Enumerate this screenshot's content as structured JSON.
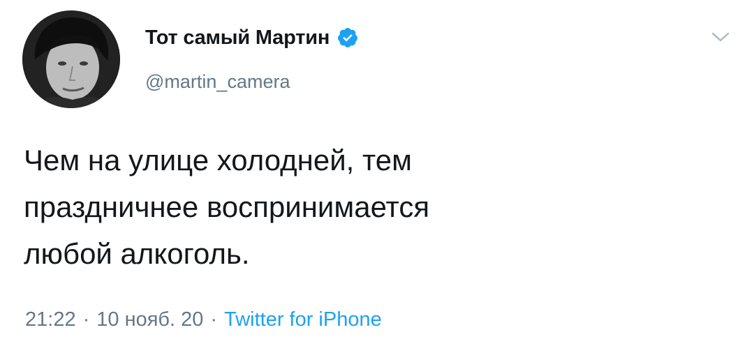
{
  "tweet": {
    "display_name": "Тот самый Мартин",
    "handle": "@martin_camera",
    "text": "Чем на улице холодней, тем\nпраздничнее воспринимается\nлюбой алкоголь.",
    "time": "21:22",
    "separator": "·",
    "date": "10 нояб. 20",
    "source": "Twitter for iPhone",
    "verified": true
  },
  "icons": {
    "verified": "verified-badge-icon",
    "menu": "chevron-down-icon"
  },
  "colors": {
    "text_primary": "#14171a",
    "text_secondary": "#657786",
    "accent": "#1da1f2"
  }
}
